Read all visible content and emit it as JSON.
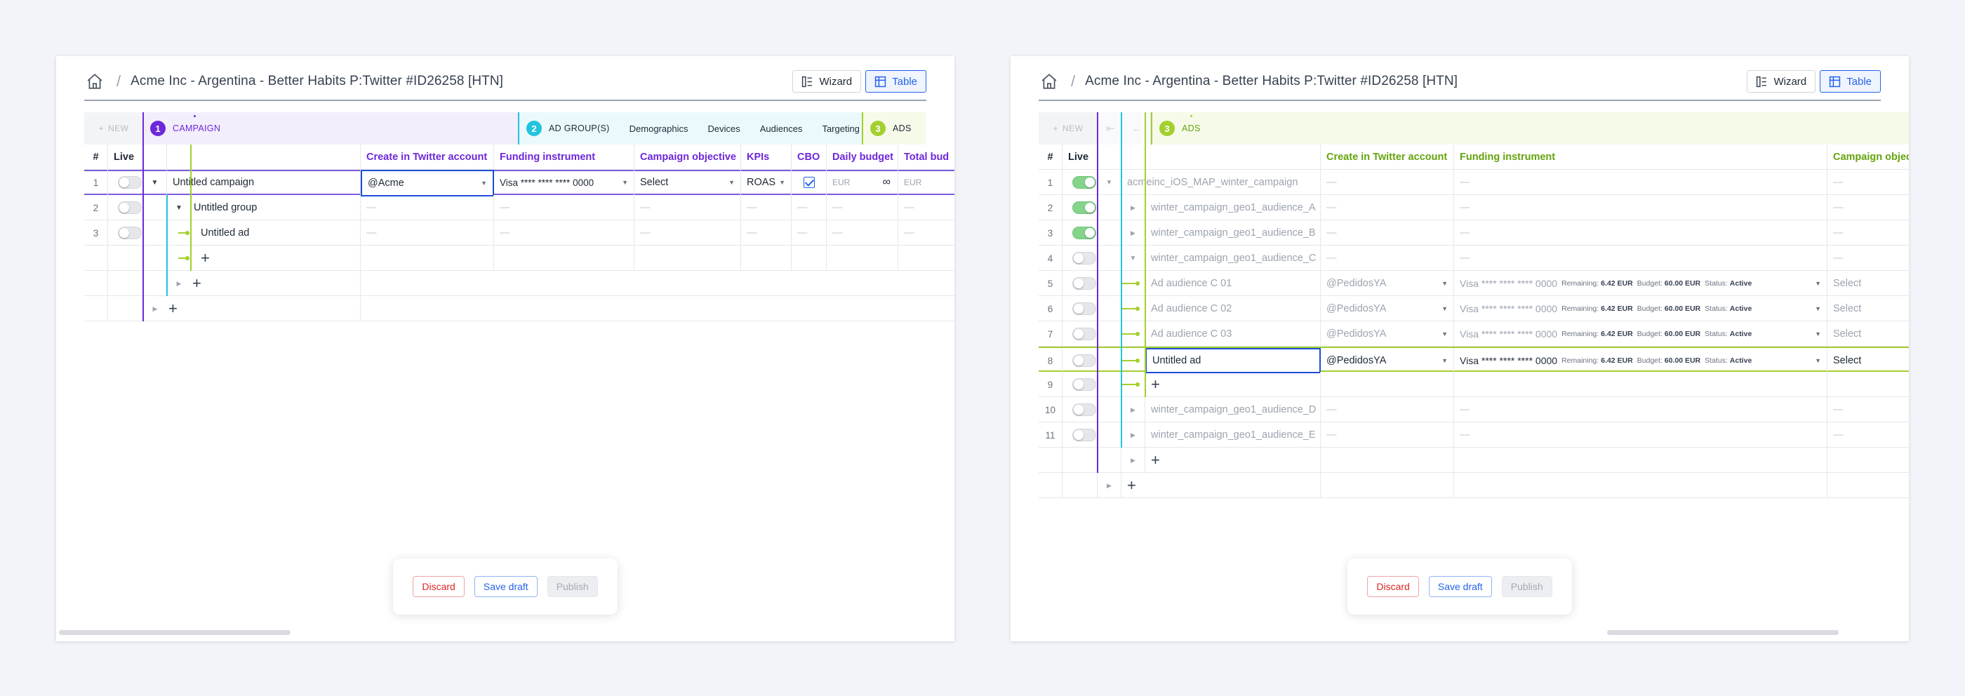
{
  "colors": {
    "campaign": "#6d28d9",
    "adgroup": "#22c3dd",
    "ads": "#a3d02d",
    "ads_text": "#65a30d",
    "primary": "#2563eb"
  },
  "common": {
    "header_title": "Acme Inc - Argentina - Better Habits P:Twitter #ID26258 [HTN]",
    "breadcrumb_separator": "/",
    "wizard_label": "Wizard",
    "table_label": "Table",
    "new_label": "NEW",
    "discard_label": "Discard",
    "save_label": "Save draft",
    "publish_label": "Publish",
    "dash": "—",
    "plus": "+"
  },
  "left": {
    "steps": [
      {
        "num": "1",
        "label": "CAMPAIGN"
      },
      {
        "num": "2",
        "label": "AD GROUP(S)"
      },
      {
        "num": "3",
        "label": "ADS"
      }
    ],
    "substeps": [
      "Demographics",
      "Devices",
      "Audiences",
      "Targeting"
    ],
    "columns": [
      "#",
      "Live",
      "",
      "",
      "Create in Twitter account",
      "Funding instrument",
      "Campaign objective",
      "KPIs",
      "CBO",
      "Daily budget",
      "Total bud"
    ],
    "rows": [
      {
        "num": "1",
        "name": "Untitled campaign",
        "account": "@Acme",
        "funding": "Visa **** **** **** 0000",
        "objective": "Select",
        "kpi": "ROAS",
        "daily_cur": "EUR",
        "daily_val": "∞",
        "total_cur": "EUR"
      },
      {
        "num": "2",
        "name": "Untitled group"
      },
      {
        "num": "3",
        "name": "Untitled ad"
      }
    ]
  },
  "right": {
    "step": {
      "num": "3",
      "label": "ADS"
    },
    "columns": [
      "#",
      "Live",
      "",
      "",
      "",
      "Create in Twitter account",
      "Funding instrument",
      "Campaign objec"
    ],
    "campaign_name": "acmeinc_iOS_MAP_winter_campaign",
    "groups_before": [
      {
        "num": "2",
        "name": "winter_campaign_geo1_audience_A",
        "live": true
      },
      {
        "num": "3",
        "name": "winter_campaign_geo1_audience_B",
        "live": true
      },
      {
        "num": "4",
        "name": "winter_campaign_geo1_audience_C",
        "live": false
      }
    ],
    "ads": [
      {
        "num": "5",
        "name": "Ad audience C 01",
        "account": "@PedidosYA",
        "funding": "Visa **** **** **** 0000",
        "remaining_label": "Remaining:",
        "remaining": "6.42 EUR",
        "budget_label": "Budget:",
        "budget": "60.00 EUR",
        "status_label": "Status:",
        "status": "Active",
        "objective": "Select"
      },
      {
        "num": "6",
        "name": "Ad audience C 02",
        "account": "@PedidosYA",
        "funding": "Visa **** **** **** 0000",
        "remaining_label": "Remaining:",
        "remaining": "6.42 EUR",
        "budget_label": "Budget:",
        "budget": "60.00 EUR",
        "status_label": "Status:",
        "status": "Active",
        "objective": "Select"
      },
      {
        "num": "7",
        "name": "Ad audience C 03",
        "account": "@PedidosYA",
        "funding": "Visa **** **** **** 0000",
        "remaining_label": "Remaining:",
        "remaining": "6.42 EUR",
        "budget_label": "Budget:",
        "budget": "60.00 EUR",
        "status_label": "Status:",
        "status": "Active",
        "objective": "Select"
      },
      {
        "num": "8",
        "name": "Untitled ad",
        "account": "@PedidosYA",
        "funding": "Visa **** **** **** 0000",
        "remaining_label": "Remaining:",
        "remaining": "6.42 EUR",
        "budget_label": "Budget:",
        "budget": "60.00 EUR",
        "status_label": "Status:",
        "status": "Active",
        "objective": "Select"
      }
    ],
    "add_ad_num": "9",
    "groups_after": [
      {
        "num": "10",
        "name": "winter_campaign_geo1_audience_D"
      },
      {
        "num": "11",
        "name": "winter_campaign_geo1_audience_E"
      }
    ],
    "first_num": "1"
  }
}
